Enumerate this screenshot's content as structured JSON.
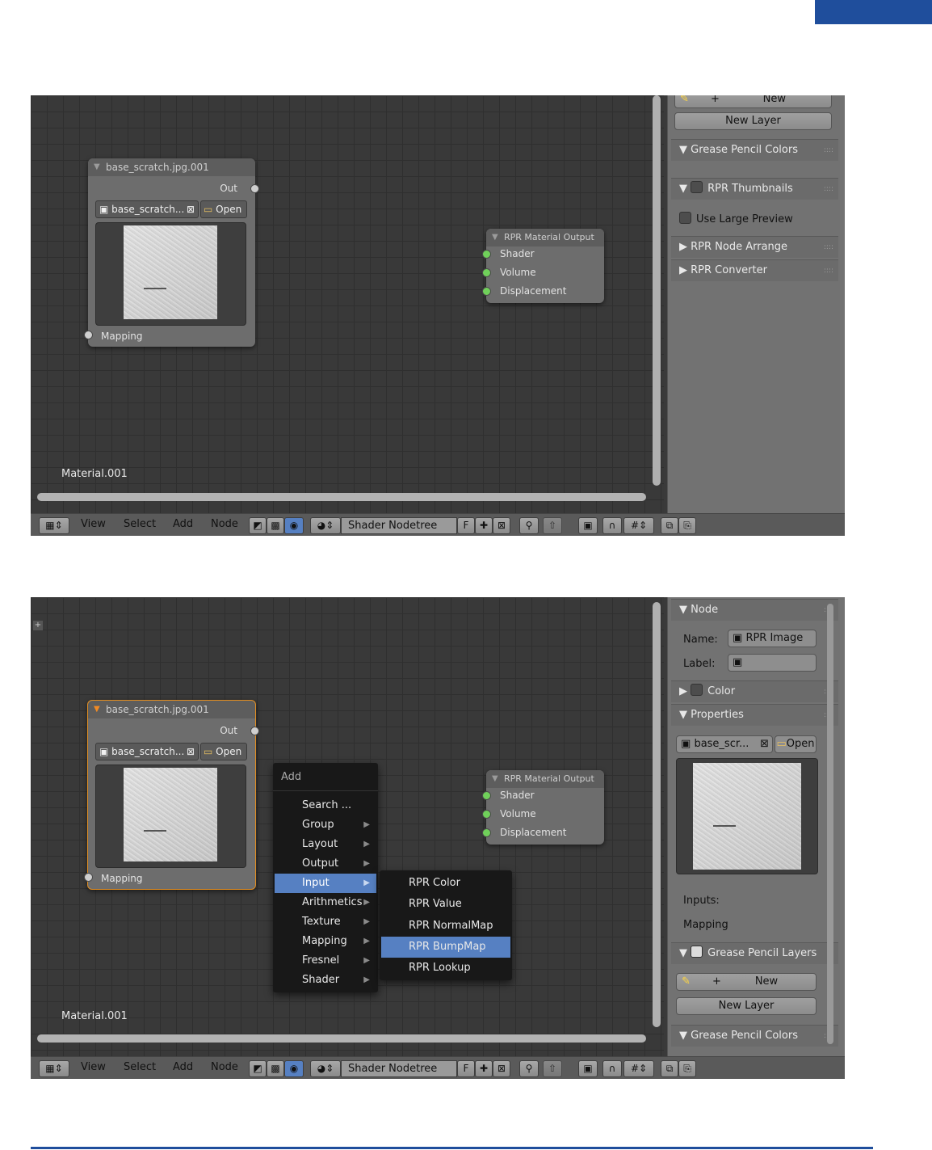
{
  "common": {
    "image_node": {
      "title": "base_scratch.jpg.001",
      "out_label": "Out",
      "image_field": "base_scratch...",
      "open_label": "Open",
      "mapping_label": "Mapping"
    },
    "output_node": {
      "title": "RPR Material Output",
      "sockets": [
        "Shader",
        "Volume",
        "Displacement"
      ]
    },
    "material_label": "Material.001",
    "header": {
      "menus": [
        "View",
        "Select",
        "Add",
        "Node"
      ],
      "nodetree": "Shader Nodetree",
      "fake_user": "F"
    }
  },
  "screenshot1": {
    "panel": {
      "new_label": "New",
      "new_layer_label": "New Layer",
      "sections": [
        "Grease Pencil Colors",
        "RPR Thumbnails",
        "RPR Node Arrange",
        "RPR Converter"
      ],
      "use_large_preview": "Use Large Preview"
    }
  },
  "screenshot2": {
    "panel": {
      "node_section": "Node",
      "name_label": "Name:",
      "name_value": "RPR Image ...",
      "label_label": "Label:",
      "color_section": "Color",
      "properties_section": "Properties",
      "image_field": "base_scr...",
      "open_label": "Open",
      "inputs_label": "Inputs:",
      "mapping_label": "Mapping",
      "gp_layers_section": "Grease Pencil Layers",
      "new_label": "New",
      "new_layer_label": "New Layer",
      "gp_colors_section": "Grease Pencil Colors"
    },
    "add_menu": {
      "title": "Add",
      "items": [
        "Search ...",
        "Group",
        "Layout",
        "Output",
        "Input",
        "Arithmetics",
        "Texture",
        "Mapping",
        "Fresnel",
        "Shader"
      ],
      "highlighted": "Input"
    },
    "input_submenu": {
      "items": [
        "RPR Color",
        "RPR Value",
        "RPR NormalMap",
        "RPR BumpMap",
        "RPR Lookup"
      ],
      "highlighted": "RPR BumpMap"
    }
  },
  "colors": {
    "accent_blue": "#1f4e9c",
    "menu_highlight": "#5680c2",
    "selected_node_outline": "#e08d22",
    "socket_green": "#70d05a"
  }
}
